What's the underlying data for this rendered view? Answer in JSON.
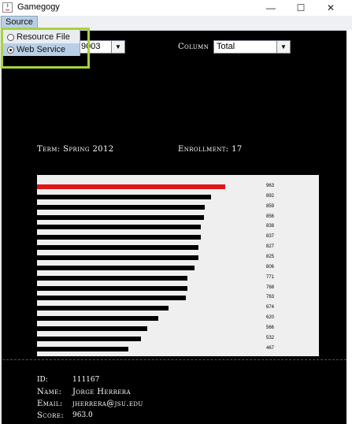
{
  "window": {
    "title": "Gamegogy",
    "minimize": "—",
    "maximize": "☐",
    "close": "✕"
  },
  "menubar": {
    "source_label": "Source"
  },
  "source_menu": {
    "items": [
      {
        "label": "Resource File",
        "selected": false
      },
      {
        "label": "Web Service",
        "selected": true
      }
    ]
  },
  "course": {
    "value": "9003"
  },
  "column": {
    "label": "Column",
    "value": "Total"
  },
  "summary": {
    "term": "Term: Spring 2012",
    "enrollment": "Enrollment: 17"
  },
  "chart_data": {
    "type": "bar",
    "orientation": "horizontal",
    "values": [
      963,
      892,
      859,
      856,
      838,
      837,
      827,
      825,
      806,
      771,
      768,
      763,
      674,
      620,
      566,
      532,
      467
    ],
    "labels": [
      "963",
      "892",
      "859",
      "856",
      "838",
      "837",
      "827",
      "825",
      "806",
      "771",
      "768",
      "763",
      "674",
      "620",
      "566",
      "532",
      "467"
    ],
    "highlight_index": 0,
    "highlight_color": "#e01515",
    "bar_color": "#000000",
    "background": "#efefef"
  },
  "student": {
    "id_label": "ID:",
    "id": "111167",
    "name_label": "Name:",
    "name": "Jorge Herrera",
    "email_label": "Email:",
    "email": "jherrera@jsu.edu",
    "score_label": "Score:",
    "score": "963.0"
  }
}
